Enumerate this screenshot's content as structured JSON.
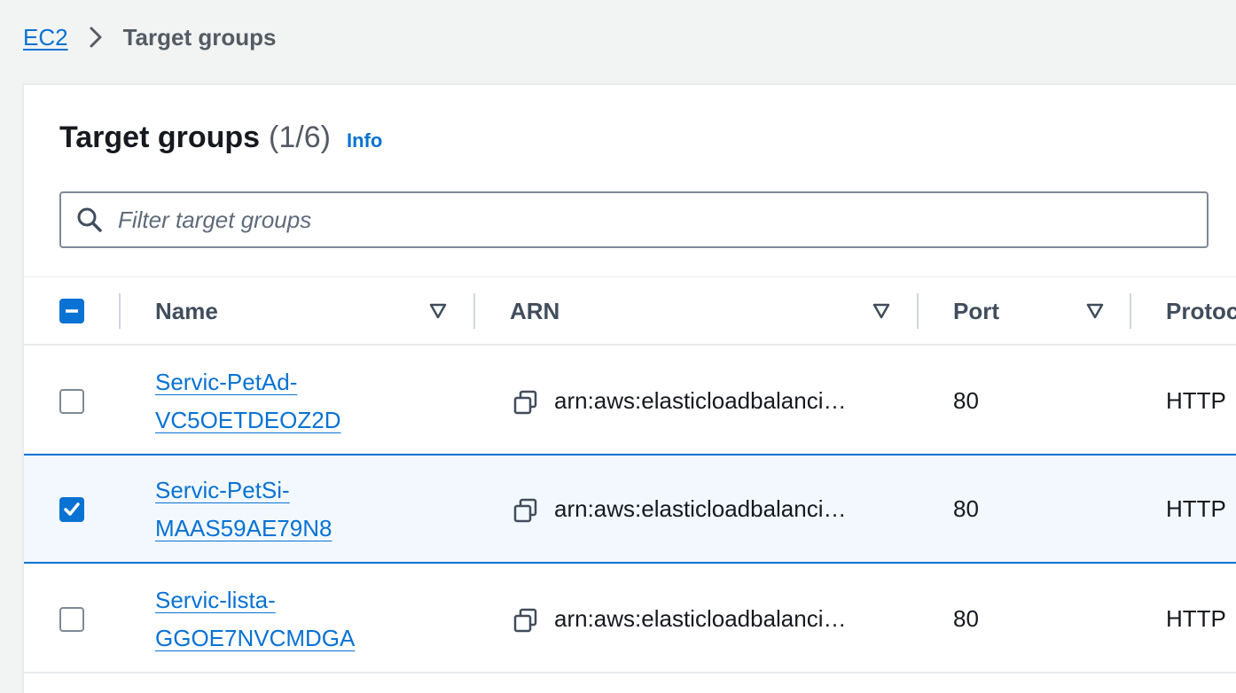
{
  "breadcrumb": {
    "parent": "EC2",
    "current": "Target groups"
  },
  "panel": {
    "title": "Target groups",
    "count": "(1/6)",
    "info_label": "Info"
  },
  "filter": {
    "placeholder": "Filter target groups",
    "value": ""
  },
  "table": {
    "columns": [
      "Name",
      "ARN",
      "Port",
      "Protoc"
    ],
    "header_checkbox_state": "indeterminate",
    "rows": [
      {
        "name_line1": "Servic-PetAd-",
        "name_line2": "VC5OETDEOZ2D",
        "arn": "arn:aws:elasticloadbalanci…",
        "port": "80",
        "protocol": "HTTP",
        "selected": false
      },
      {
        "name_line1": "Servic-PetSi-",
        "name_line2": "MAAS59AE79N8",
        "arn": "arn:aws:elasticloadbalanci…",
        "port": "80",
        "protocol": "HTTP",
        "selected": true
      },
      {
        "name_line1": "Servic-lista-",
        "name_line2": "GGOE7NVCMDGA",
        "arn": "arn:aws:elasticloadbalanci…",
        "port": "80",
        "protocol": "HTTP",
        "selected": false
      }
    ]
  },
  "colors": {
    "link": "#0972d3",
    "selected_row_bg": "#f2f8fd",
    "page_bg": "#f2f3f3"
  },
  "icons": {
    "breadcrumb_separator": "chevron-right-icon",
    "search": "search-icon",
    "sort": "sort-triangle-down-icon",
    "copy": "copy-icon",
    "checkmark": "checkmark-icon"
  }
}
